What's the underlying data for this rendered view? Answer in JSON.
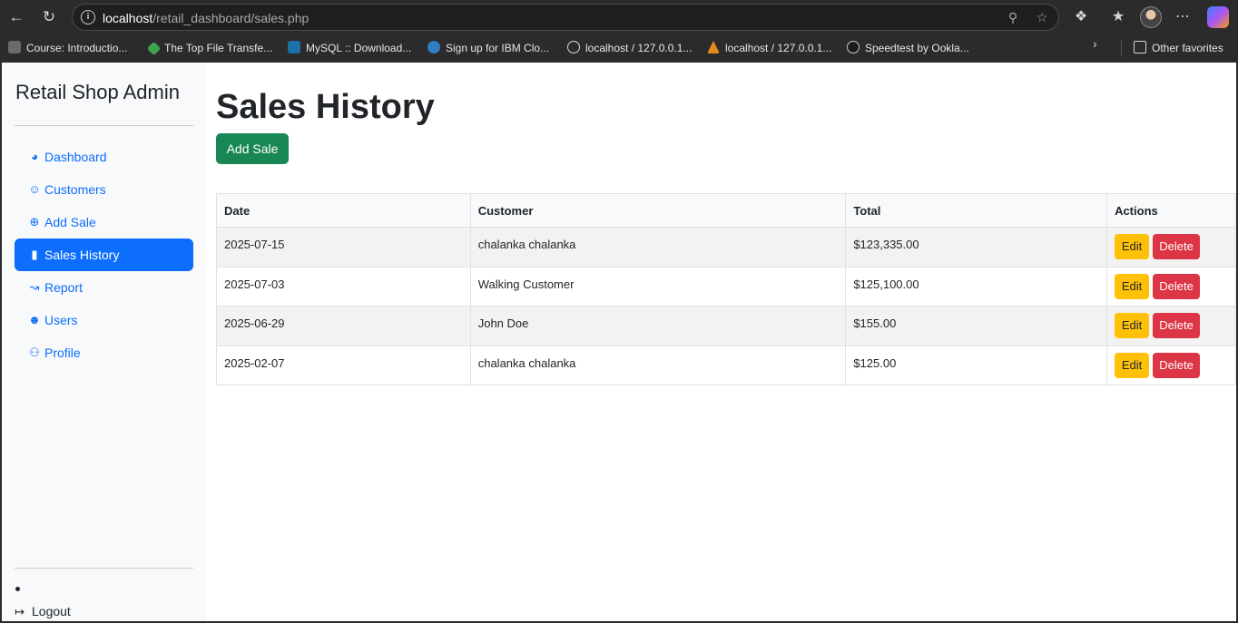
{
  "browser": {
    "url_host": "localhost",
    "url_path": "/retail_dashboard/sales.php",
    "bookmarks": [
      {
        "label": "Course: Introductio..."
      },
      {
        "label": "The Top File Transfe..."
      },
      {
        "label": "MySQL :: Download..."
      },
      {
        "label": "Sign up for IBM Clo..."
      },
      {
        "label": "localhost / 127.0.0.1..."
      },
      {
        "label": "localhost / 127.0.0.1..."
      },
      {
        "label": "Speedtest by Ookla..."
      }
    ],
    "other_favorites": "Other favorites"
  },
  "sidebar": {
    "brand": "Retail Shop Admin",
    "items": [
      {
        "label": "Dashboard",
        "icon": "speedometer-icon"
      },
      {
        "label": "Customers",
        "icon": "people-icon"
      },
      {
        "label": "Add Sale",
        "icon": "plus-circle-icon"
      },
      {
        "label": "Sales History",
        "icon": "bar-chart-icon",
        "active": true
      },
      {
        "label": "Report",
        "icon": "line-chart-icon"
      },
      {
        "label": "Users",
        "icon": "people-fill-icon"
      },
      {
        "label": "Profile",
        "icon": "person-icon"
      }
    ],
    "logout": "Logout"
  },
  "main": {
    "title": "Sales History",
    "add_button": "Add Sale",
    "table": {
      "headers": [
        "Date",
        "Customer",
        "Total",
        "Actions"
      ],
      "rows": [
        {
          "date": "2025-07-15",
          "customer": "chalanka chalanka",
          "total": "$123,335.00"
        },
        {
          "date": "2025-07-03",
          "customer": "Walking Customer",
          "total": "$125,100.00"
        },
        {
          "date": "2025-06-29",
          "customer": "John Doe",
          "total": "$155.00"
        },
        {
          "date": "2025-02-07",
          "customer": "chalanka chalanka",
          "total": "$125.00"
        }
      ],
      "edit_label": "Edit",
      "delete_label": "Delete"
    }
  },
  "colors": {
    "primary": "#0d6efd",
    "success": "#198754",
    "warning": "#ffc107",
    "danger": "#dc3545"
  }
}
